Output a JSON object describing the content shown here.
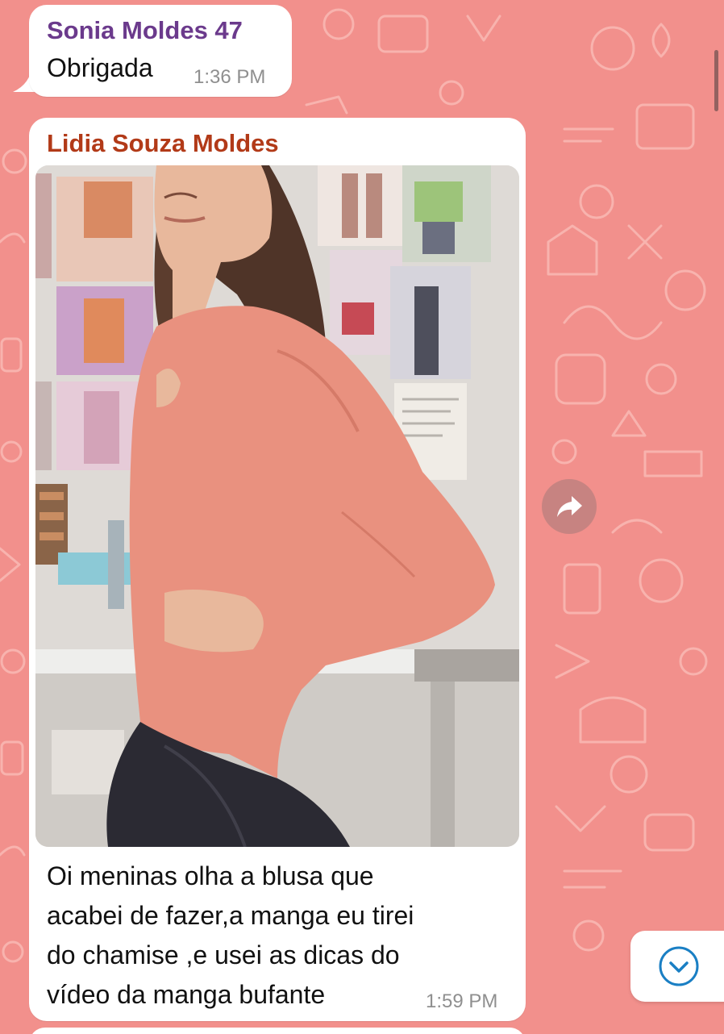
{
  "chat": {
    "background_color": "#f2908c",
    "messages": [
      {
        "sender": "Sonia Moldes 47",
        "sender_color": "#6b3a8c",
        "text": "Obrigada",
        "time": "1:36 PM"
      },
      {
        "sender": "Lidia Souza Moldes",
        "sender_color": "#b23a18",
        "media": "photo",
        "caption": "Oi meninas olha a blusa que\nacabei de fazer,a manga eu tirei\ndo chamise ,e usei as dicas  do\nvídeo da manga bufante",
        "time": "1:59 PM"
      }
    ]
  },
  "controls": {
    "forward_icon": "forward-arrow-icon",
    "scroll_down_icon": "chevron-down-circle-icon",
    "accent_color": "#1a7fc4"
  }
}
